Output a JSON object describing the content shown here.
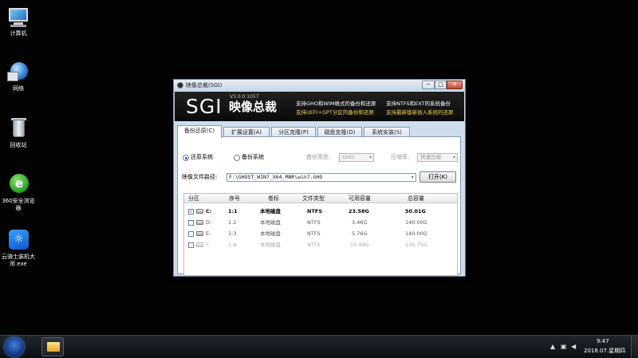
{
  "desktop": {
    "icons": [
      {
        "label": "计算机",
        "icon": "computer-icon"
      },
      {
        "label": "网络",
        "icon": "network-icon"
      },
      {
        "label": "回收站",
        "icon": "recycle-bin-icon"
      },
      {
        "label": "360安全浏览器",
        "icon": "browser-360-icon"
      },
      {
        "label": "云骑士装机大师.exe",
        "icon": "yunqishi-icon"
      }
    ]
  },
  "window": {
    "title": "映像总裁(SGI)",
    "controls": {
      "minimize": "─",
      "maximize": "□",
      "close": "✕"
    },
    "banner": {
      "logo": "SGI",
      "version": "V3.0.0.1057",
      "brand": "映像总裁",
      "features": [
        "支持GHO和WIM格式的备份和还原",
        "支持NTFS和EXT的系统备份",
        "支持UEFI+GPT分区的备份和还原",
        "支持最新版新插入系统的还原"
      ],
      "feature_colors": [
        "#ffffff",
        "#ffffff",
        "#f3d24a",
        "#f3d24a"
      ]
    },
    "tabs": [
      "备份还原(C)",
      "扩展设置(A)",
      "分区克隆(P)",
      "磁盘克隆(D)",
      "系统安装(S)"
    ],
    "active_tab": 0,
    "radios": {
      "restore": "还原系统",
      "backup": "备份系统",
      "selected": "restore"
    },
    "backup_type_label": "备份类型:",
    "backup_type_value": "GHO",
    "compress_label": "压缩率:",
    "compress_value": "快速压缩",
    "image_path_label": "映像文件路径:",
    "image_path_value": "F:\\GHOST_WIN7_X64_MBR\\win7.GHO",
    "open_button": "打开(K)",
    "table": {
      "columns": [
        "分区",
        "序号",
        "卷标",
        "文件类型",
        "可用容量",
        "总容量"
      ],
      "rows": [
        {
          "drive": "C:",
          "index": "1:1",
          "label": "本地磁盘",
          "fs": "NTFS",
          "free": "23.58G",
          "total": "50.01G",
          "checked": true,
          "state": "sel"
        },
        {
          "drive": "D:",
          "index": "1:2",
          "label": "本地磁盘",
          "fs": "NTFS",
          "free": "3.46G",
          "total": "140.00G",
          "checked": false,
          "state": "dim"
        },
        {
          "drive": "E:",
          "index": "1:3",
          "label": "本地磁盘",
          "fs": "NTFS",
          "free": "5.76G",
          "total": "140.00G",
          "checked": false,
          "state": "dim"
        },
        {
          "drive": "F:",
          "index": "1:4",
          "label": "本地磁盘",
          "fs": "NTFS",
          "free": "10.49G",
          "total": "135.75G",
          "checked": false,
          "state": "dis"
        }
      ]
    }
  },
  "taskbar": {
    "time": "9:47",
    "date": "2018.07.星期四"
  }
}
